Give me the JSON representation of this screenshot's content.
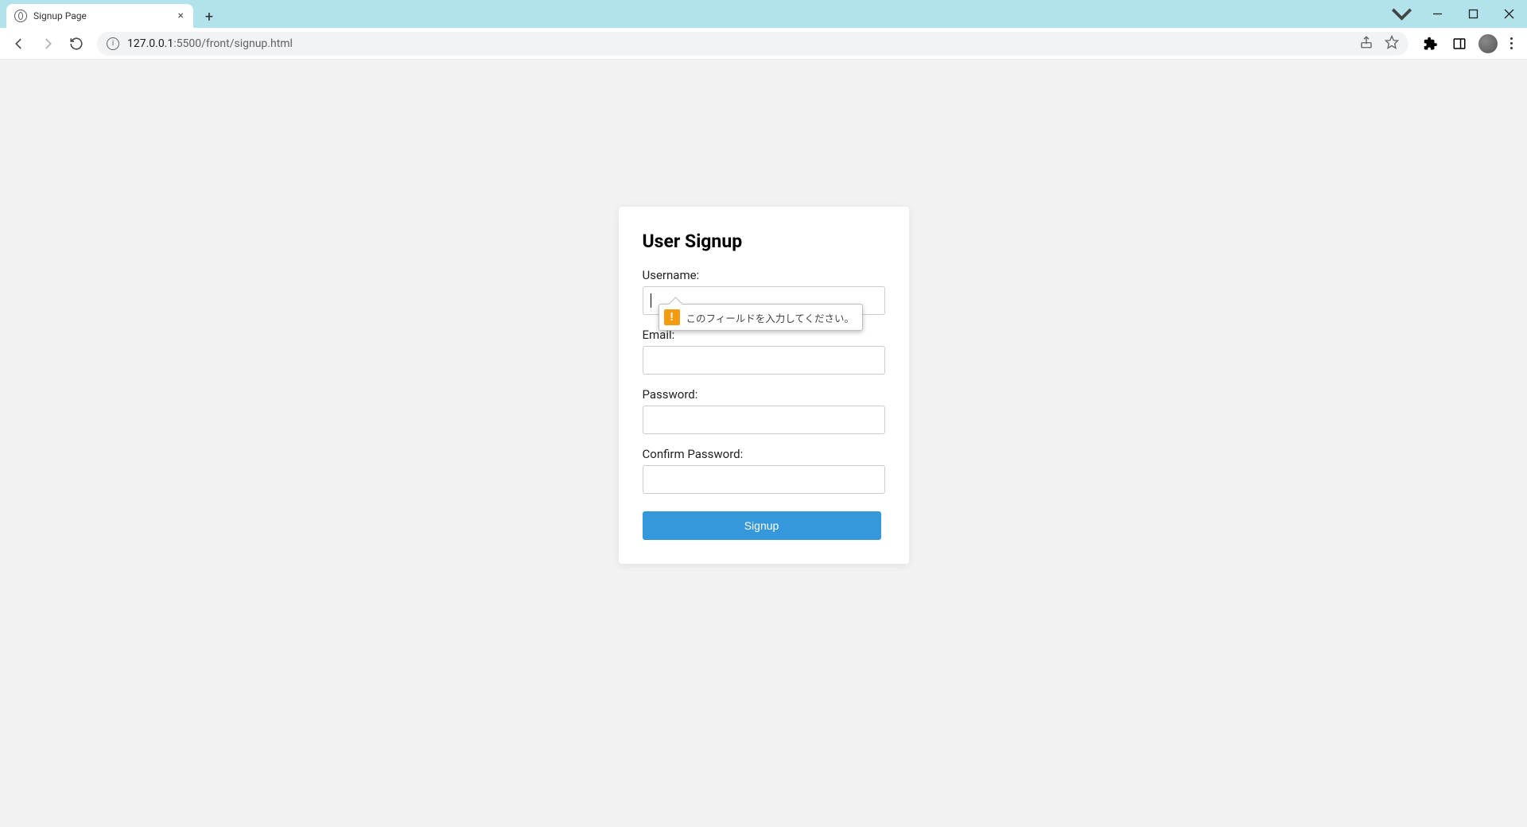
{
  "browser": {
    "tab_title": "Signup Page",
    "url_host": "127.0.0.1",
    "url_port_path": ":5500/front/signup.html"
  },
  "form": {
    "heading": "User Signup",
    "username_label": "Username:",
    "email_label": "Email:",
    "password_label": "Password:",
    "confirm_label": "Confirm Password:",
    "submit_label": "Signup"
  },
  "validation": {
    "message": "このフィールドを入力してください。"
  }
}
